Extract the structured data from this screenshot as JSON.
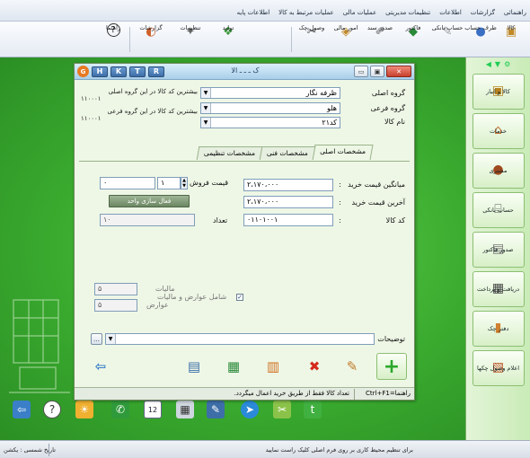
{
  "menu": {
    "items": [
      "اطلاعات پایه",
      "عملیات مرتبط به کالا",
      "عملیات مالی",
      "تنظیمات مدیریتی",
      "اطلاعات",
      "گزارشات",
      "راهنمائی"
    ]
  },
  "toolbar": {
    "buttons": [
      {
        "label": "کالا",
        "icon": "box-icon"
      },
      {
        "label": "طرف حساب",
        "icon": "person-icon"
      },
      {
        "label": "حساب بانکی",
        "icon": "bank-icon"
      },
      {
        "label": "فاکتور",
        "icon": "invoice-icon"
      },
      {
        "label": "صدور سند",
        "icon": "document-icon"
      },
      {
        "label": "امور مالی",
        "icon": "finance-icon"
      },
      {
        "label": "وصول چک",
        "icon": "check-icon"
      },
      {
        "label": "تولید",
        "icon": "production-icon"
      },
      {
        "label": "تنظیمات",
        "icon": "settings-icon"
      },
      {
        "label": "گزارشات",
        "icon": "report-icon"
      },
      {
        "label": "راهنما",
        "icon": "help-icon"
      }
    ]
  },
  "sidebar": {
    "items": [
      {
        "label": "کالا و انبار",
        "icon": "warehouse-icon"
      },
      {
        "label": "خدمات",
        "icon": "services-icon"
      },
      {
        "label": "مشتری",
        "icon": "customer-icon"
      },
      {
        "label": "حساب بانکی",
        "icon": "bank-icon"
      },
      {
        "label": "صدور فاکتور",
        "icon": "invoice-icon"
      },
      {
        "label": "دریافت و پرداخت",
        "icon": "payment-icon"
      },
      {
        "label": "دفتر چک",
        "icon": "checkbook-icon"
      },
      {
        "label": "اعلام وصول چکها",
        "icon": "cheque-notice-icon"
      }
    ]
  },
  "dialog": {
    "title": "ک ـ ـ ـ الا",
    "keys": [
      "H",
      "K",
      "T",
      "R"
    ],
    "fields": {
      "main_group_label": "گروه اصلی",
      "main_group_value": "ظرفه نگار",
      "sub_group_label": "گروه فرعی",
      "sub_group_value": "هلو",
      "item_name_label": "نام کالا",
      "item_name_value": "کد۲۱",
      "hint_main": "بیشترین کد کالا در این گروه اصلی",
      "hint_main_value": "۱۱۰۰۰۱",
      "hint_sub": "بیشترین کد کالا در این گروه فرعی",
      "hint_sub_value": "۱۱۰۰۰۱"
    },
    "tabs": [
      "مشخصات اصلی",
      "مشخصات فنی",
      "مشخصات تنظیمی"
    ],
    "main_tab": {
      "avg_price_label": "میانگین قیمت خرید",
      "avg_price_value": "۲،۱۷۰،۰۰۰",
      "last_price_label": "آخرین قیمت خرید",
      "last_price_value": "۲،۱۷۰،۰۰۰",
      "code_label": "کد کالا",
      "code_value": "۰۱۱۰۱۰۰۱",
      "sale_price_label": "قیمت فروش",
      "sale_price_value": "۰",
      "sale_qty_value": "۱",
      "activate_unit_button": "فعال سازی واحد",
      "count_label": "تعداد",
      "count_value": "۱۰",
      "tax_label": "مالیات",
      "tax_value": "۵",
      "duty_label": "عوارض",
      "duty_value": "۵",
      "include_tax_label": "شامل عوارض و مالیات",
      "description_label": "توضیحات"
    },
    "status": {
      "shortcut": "راهنما=Ctrl+F1",
      "message": "تعداد کالا فقط از طریق خرید اعمال میگردد."
    }
  },
  "status_bar": {
    "left": "تاریخ شمسی : یکشن",
    "right": "برای تنظیم محیط کاری بر روی فرم اصلی کلیک راست نمایید"
  },
  "colors": {
    "desktop": "#3aab2f",
    "dialog_bg": "#eef7e6",
    "add_green": "#2aa82a",
    "delete_red": "#d42a1c"
  }
}
